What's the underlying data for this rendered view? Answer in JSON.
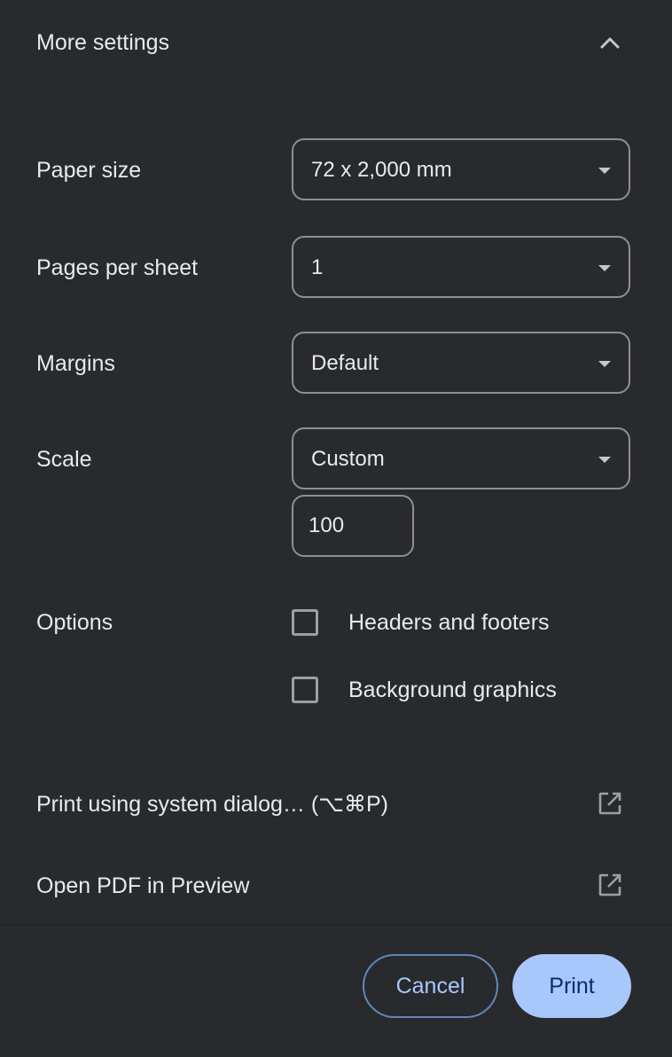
{
  "header": {
    "title": "More settings",
    "expand_icon": "chevron-up-icon"
  },
  "paper_size": {
    "label": "Paper size",
    "value": "72 x 2,000 mm"
  },
  "pages_per_sheet": {
    "label": "Pages per sheet",
    "value": "1"
  },
  "margins": {
    "label": "Margins",
    "value": "Default"
  },
  "scale": {
    "label": "Scale",
    "value": "Custom",
    "custom_value": "100"
  },
  "options": {
    "label": "Options",
    "items": [
      {
        "label": "Headers and footers",
        "checked": false
      },
      {
        "label": "Background graphics",
        "checked": false
      }
    ]
  },
  "links": {
    "system_dialog": {
      "label": "Print using system dialog… (⌥⌘P)",
      "icon": "open-in-new-icon"
    },
    "open_pdf": {
      "label": "Open PDF in Preview",
      "icon": "open-in-new-icon"
    }
  },
  "footer": {
    "cancel_label": "Cancel",
    "print_label": "Print"
  },
  "colors": {
    "background": "#292a2d",
    "text": "#e8eaed",
    "accent": "#a8c7fa",
    "border": "#8d8f93"
  }
}
